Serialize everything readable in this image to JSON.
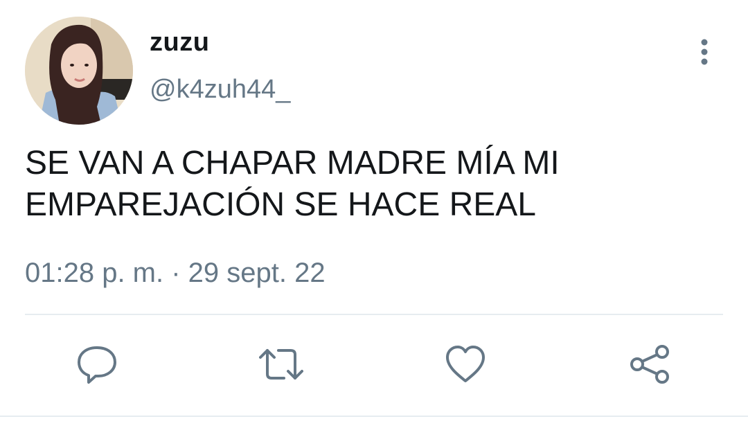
{
  "author": {
    "display_name": "zuzu",
    "handle": "@k4zuh44_"
  },
  "tweet": {
    "lines": [
      "SE VAN A CHAPAR MADRE MÍA MI",
      "EMPAREJACIÓN SE HACE REAL"
    ],
    "timestamp": "01:28 p. m. · 29 sept. 22"
  },
  "icons": {
    "more": "more-vertical-icon",
    "reply": "reply-icon",
    "retweet": "retweet-icon",
    "like": "heart-icon",
    "share": "share-icon"
  },
  "colors": {
    "text": "#14171a",
    "secondary": "#657786",
    "divider": "#e6ecf0"
  }
}
